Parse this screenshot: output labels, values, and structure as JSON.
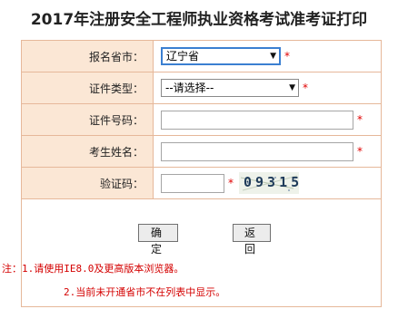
{
  "page_title": "2017年注册安全工程师执业资格考试准考证打印",
  "form": {
    "rows": [
      {
        "label": "报名省市：",
        "value": "辽宁省"
      },
      {
        "label": "证件类型：",
        "value": "--请选择--"
      },
      {
        "label": "证件号码：",
        "value": ""
      },
      {
        "label": "考生姓名：",
        "value": ""
      },
      {
        "label": "验证码：",
        "value": ""
      }
    ],
    "required_mark": "*",
    "captcha_text": "09315"
  },
  "buttons": {
    "confirm": "确定",
    "back": "返回"
  },
  "notes": {
    "line1": "注：1.请使用IE8.0及更高版本浏览器。",
    "line2": "2.当前未开通省市不在列表中显示。"
  },
  "colors": {
    "label_bg": "#fbe7d5",
    "border": "#e6b89a",
    "required": "#e00000",
    "select_focus": "#3b7fd1"
  }
}
